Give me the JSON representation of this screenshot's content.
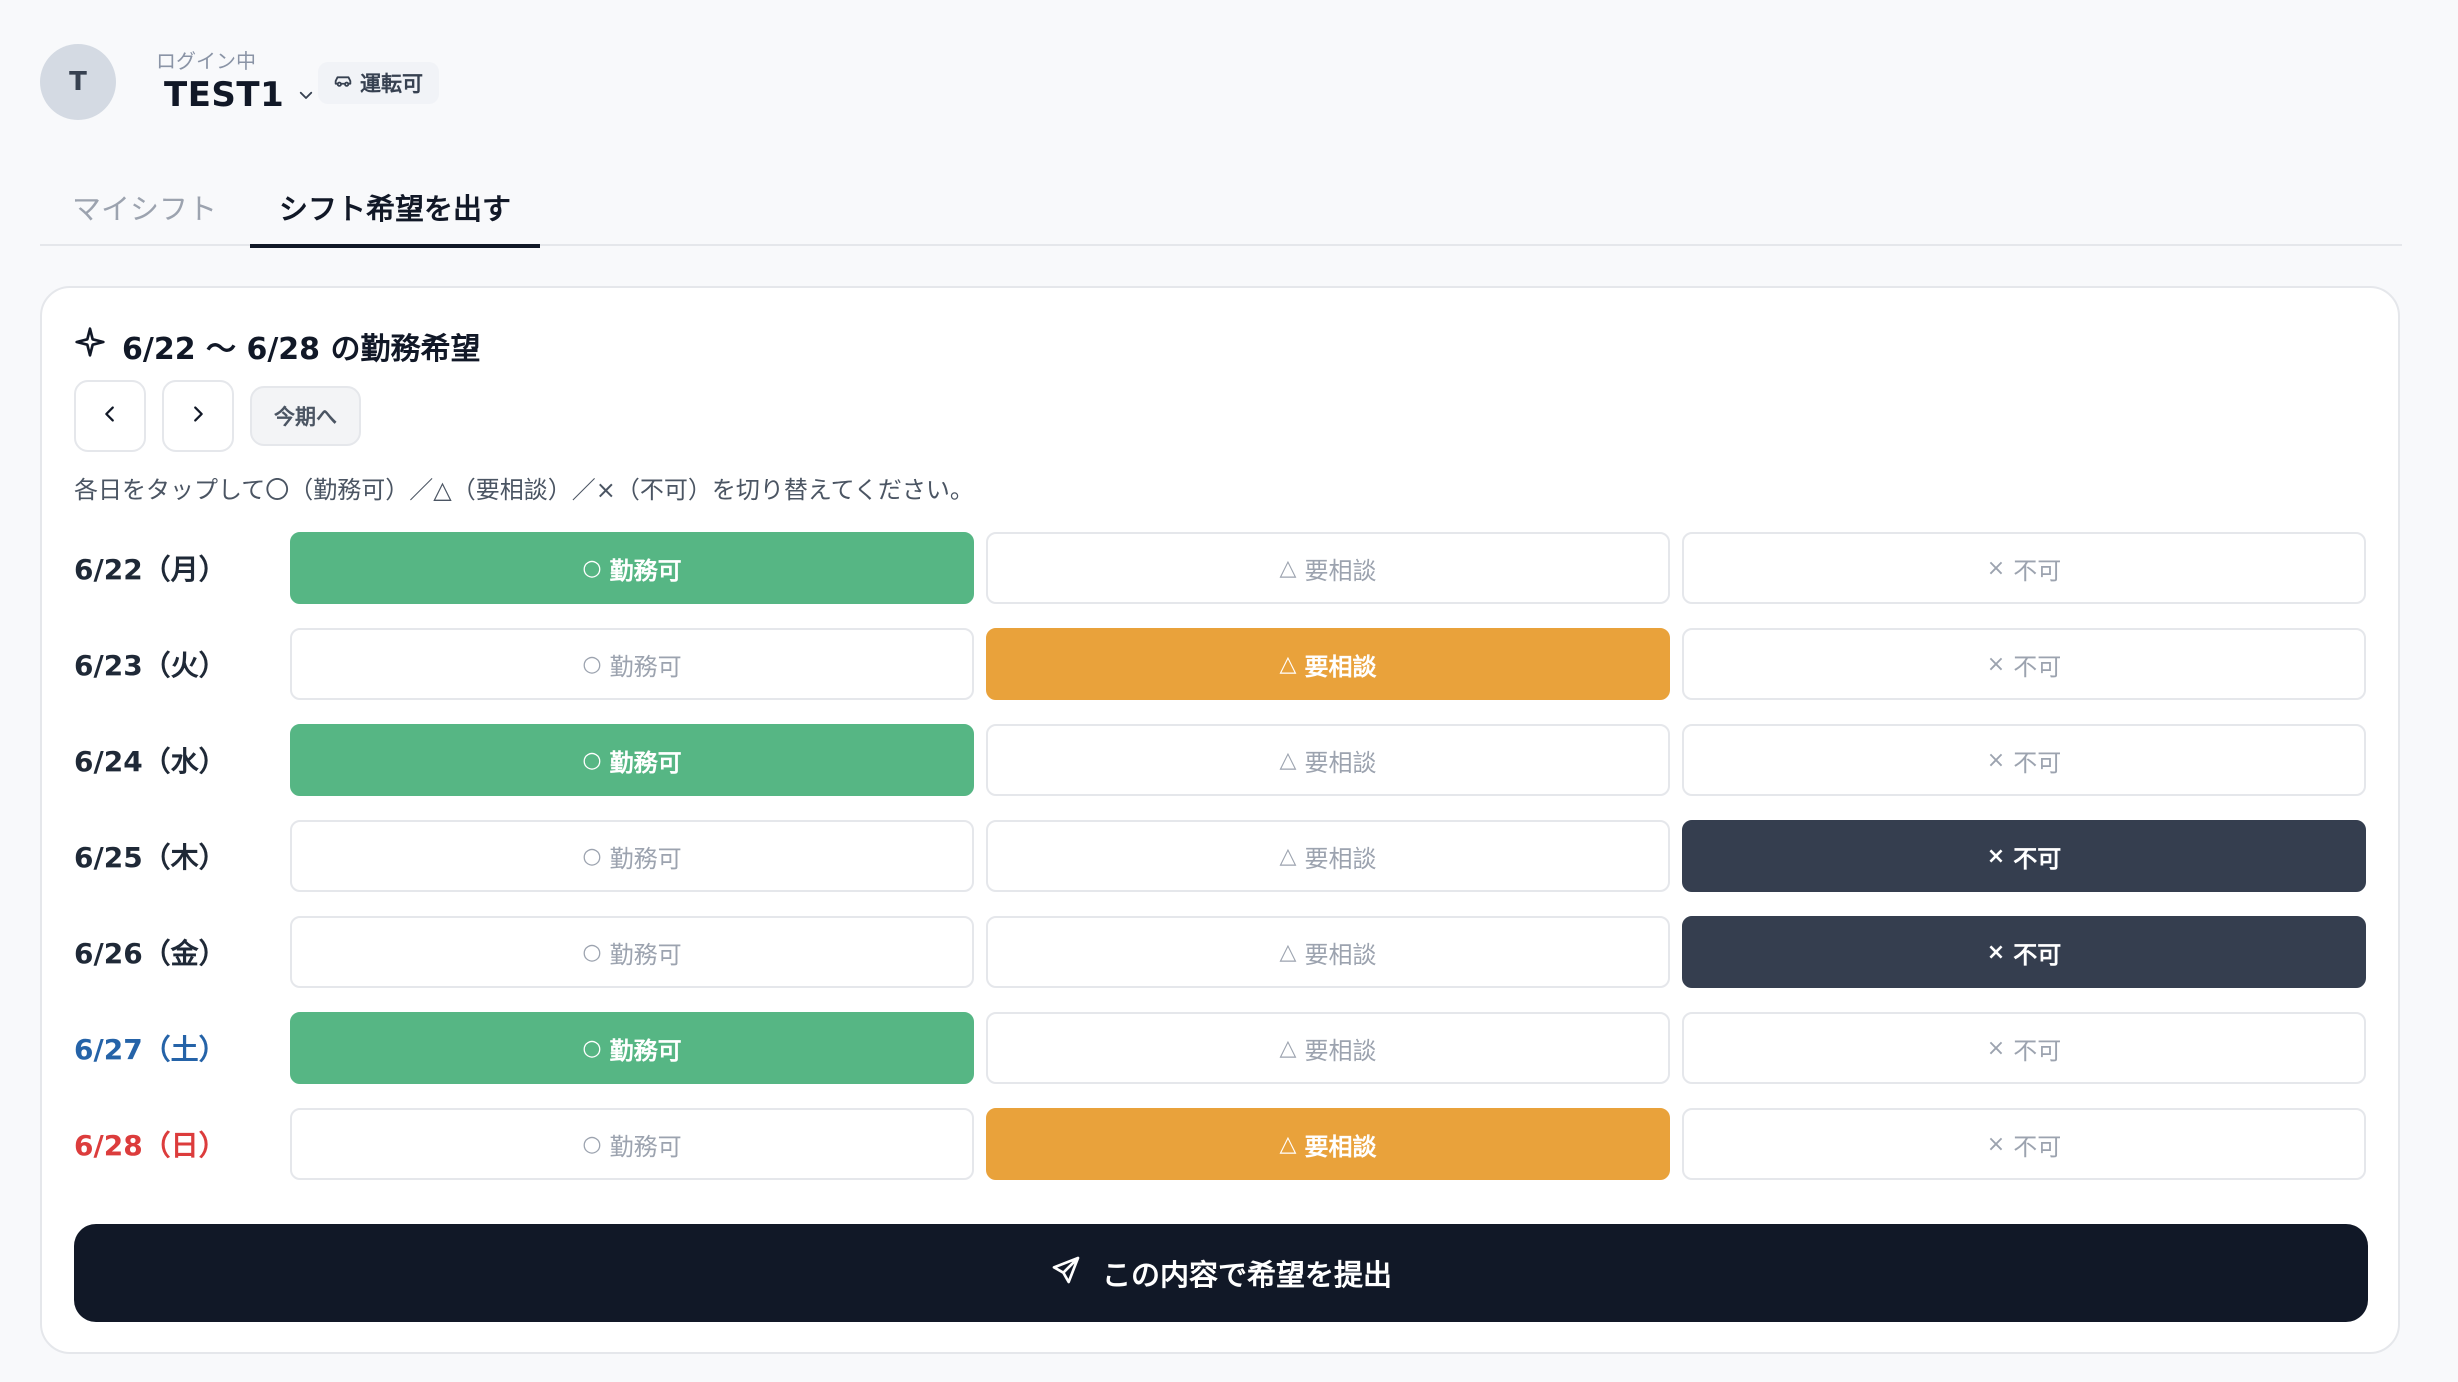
{
  "user": {
    "avatar_initial": "T",
    "login_label": "ログイン中",
    "name": "TEST1",
    "badge": "運転可"
  },
  "tabs": [
    {
      "label": "マイシフト",
      "active": false
    },
    {
      "label": "シフト希望を出す",
      "active": true
    }
  ],
  "card": {
    "title": "6/22 〜 6/28 の勤務希望",
    "today_label": "今期へ",
    "instruction": "各日をタップして〇（勤務可）／△（要相談）／×（不可）を切り替えてください。",
    "options": {
      "ok": {
        "symbol": "○",
        "label": "勤務可"
      },
      "maybe": {
        "symbol": "△",
        "label": "要相談"
      },
      "no": {
        "symbol": "×",
        "label": "不可"
      }
    },
    "days": [
      {
        "date": "6/22（月）",
        "selected": "ok"
      },
      {
        "date": "6/23（火）",
        "selected": "maybe"
      },
      {
        "date": "6/24（水）",
        "selected": "ok"
      },
      {
        "date": "6/25（木）",
        "selected": "no"
      },
      {
        "date": "6/26（金）",
        "selected": "no"
      },
      {
        "date": "6/27（土）",
        "selected": "ok"
      },
      {
        "date": "6/28（日）",
        "selected": "maybe"
      }
    ],
    "submit_label": "この内容で希望を提出"
  },
  "colors": {
    "ok": "#56b684",
    "maybe": "#e9a23b",
    "no": "#353e4f",
    "saturday": "#2563a8",
    "sunday": "#dc3c3c"
  }
}
